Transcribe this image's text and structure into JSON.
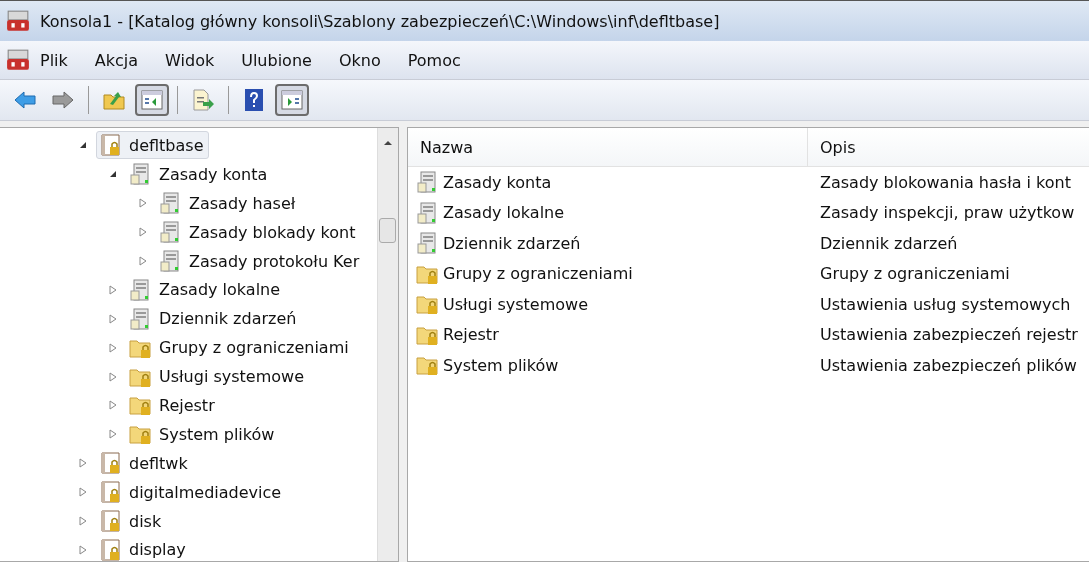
{
  "window": {
    "title": "Konsola1 - [Katalog główny konsoli\\Szablony zabezpieczeń\\C:\\Windows\\inf\\defltbase]"
  },
  "menu": [
    "Plik",
    "Akcja",
    "Widok",
    "Ulubione",
    "Okno",
    "Pomoc"
  ],
  "toolbar": [
    {
      "kind": "back",
      "pressed": false
    },
    {
      "kind": "forward",
      "pressed": false
    },
    {
      "kind": "sep"
    },
    {
      "kind": "up",
      "pressed": false
    },
    {
      "kind": "tree",
      "pressed": true
    },
    {
      "kind": "sep"
    },
    {
      "kind": "export",
      "pressed": false
    },
    {
      "kind": "sep"
    },
    {
      "kind": "help",
      "pressed": false
    },
    {
      "kind": "action",
      "pressed": true
    }
  ],
  "tree": [
    {
      "label": "defltbase",
      "kind": "template",
      "expanded": true,
      "selected": true,
      "children": [
        {
          "label": "Zasady konta",
          "kind": "policy",
          "expanded": true,
          "selected": false,
          "children": [
            {
              "label": "Zasady haseł",
              "kind": "policy",
              "expanded": false,
              "selected": false
            },
            {
              "label": "Zasady blokady kont",
              "kind": "policy",
              "expanded": false,
              "selected": false
            },
            {
              "label": "Zasady protokołu Ker",
              "kind": "policy",
              "expanded": false,
              "selected": false
            }
          ]
        },
        {
          "label": "Zasady lokalne",
          "kind": "policy",
          "expanded": false,
          "selected": false
        },
        {
          "label": "Dziennik zdarzeń",
          "kind": "policy",
          "expanded": false,
          "selected": false
        },
        {
          "label": "Grupy z ograniczeniami",
          "kind": "folder",
          "expanded": false,
          "selected": false
        },
        {
          "label": "Usługi systemowe",
          "kind": "folder",
          "expanded": false,
          "selected": false
        },
        {
          "label": "Rejestr",
          "kind": "folder",
          "expanded": false,
          "selected": false
        },
        {
          "label": "System plików",
          "kind": "folder",
          "expanded": false,
          "selected": false
        }
      ]
    },
    {
      "label": "defltwk",
      "kind": "template",
      "expanded": false,
      "selected": false
    },
    {
      "label": "digitalmediadevice",
      "kind": "template",
      "expanded": false,
      "selected": false
    },
    {
      "label": "disk",
      "kind": "template",
      "expanded": false,
      "selected": false
    },
    {
      "label": "display",
      "kind": "template",
      "expanded": false,
      "selected": false
    }
  ],
  "table": {
    "columns": [
      "Nazwa",
      "Opis"
    ],
    "rows": [
      {
        "kind": "policy",
        "name": "Zasady konta",
        "description": "Zasady blokowania hasła i kont"
      },
      {
        "kind": "policy",
        "name": "Zasady lokalne",
        "description": "Zasady inspekcji, praw użytkow"
      },
      {
        "kind": "policy",
        "name": "Dziennik zdarzeń",
        "description": "Dziennik zdarzeń"
      },
      {
        "kind": "folder",
        "name": "Grupy z ograniczeniami",
        "description": "Grupy z ograniczeniami"
      },
      {
        "kind": "folder",
        "name": "Usługi systemowe",
        "description": "Ustawienia usług systemowych"
      },
      {
        "kind": "folder",
        "name": "Rejestr",
        "description": "Ustawienia zabezpieczeń rejestr"
      },
      {
        "kind": "folder",
        "name": "System plików",
        "description": "Ustawienia zabezpieczeń plików"
      }
    ]
  }
}
